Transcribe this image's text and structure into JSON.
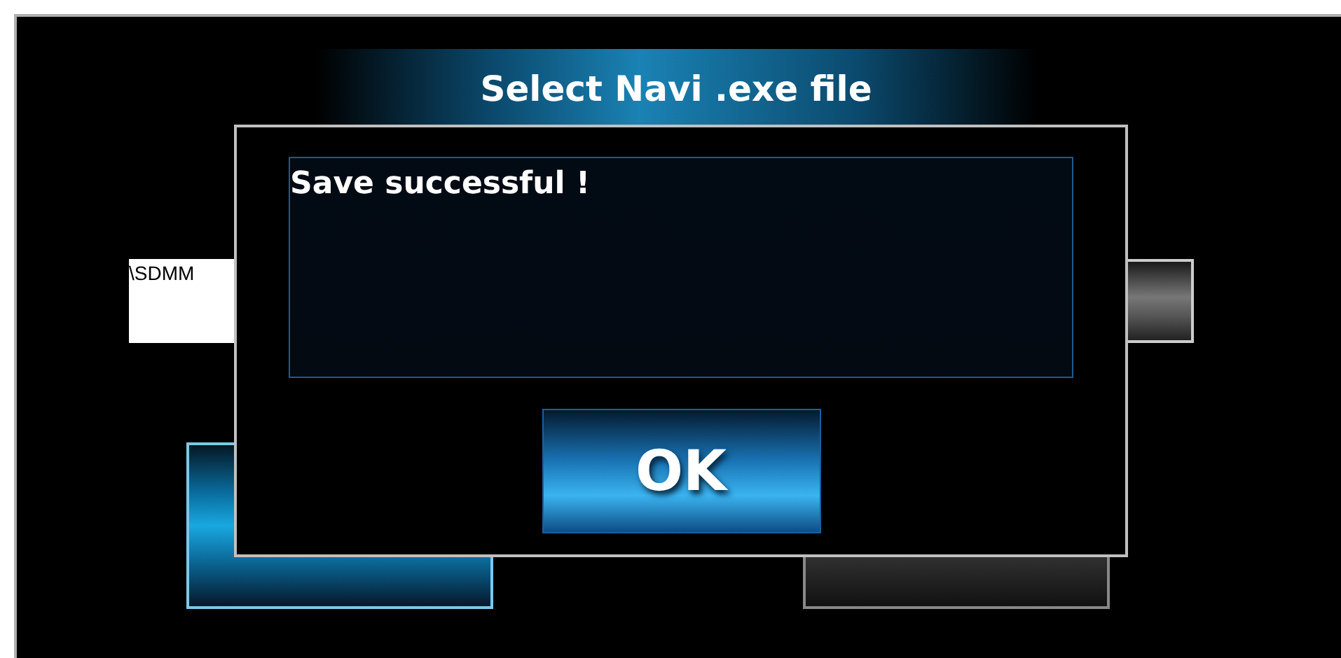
{
  "screen": {
    "title": "Select Navi .exe file",
    "path_field": {
      "value": "\\SDMM"
    }
  },
  "dialog": {
    "message": "Save successful !",
    "buttons": [
      {
        "label": "OK"
      }
    ]
  }
}
